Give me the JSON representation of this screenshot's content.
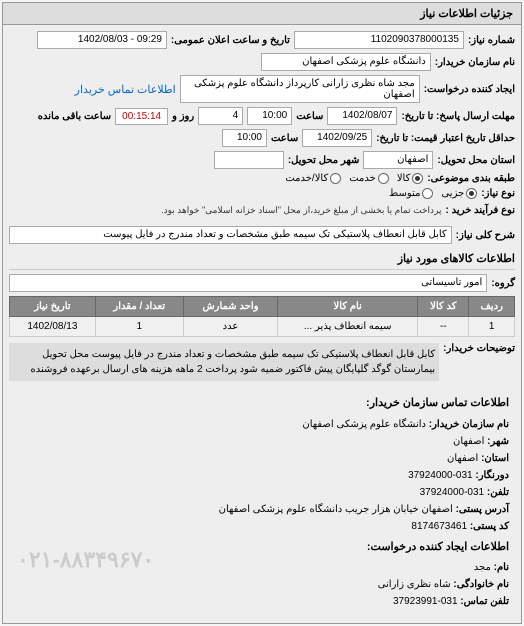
{
  "panel_title": "جزئیات اطلاعات نیاز",
  "fields": {
    "request_no_label": "شماره نیاز:",
    "request_no": "1102090378000135",
    "public_date_label": "تاریخ و ساعت اعلان عمومی:",
    "public_date": "09:29 - 1402/08/03",
    "buyer_name_label": "نام سازمان خریدار:",
    "buyer_name": "دانشگاه علوم پزشکی اصفهان",
    "requester_label": "ایجاد کننده درخواست:",
    "requester": "مجد شاه نظری زارانی کارپرداز دانشگاه علوم پزشکی اصفهان",
    "buyer_contact_link": "اطلاعات تماس خریدار",
    "response_deadline_label": "مهلت ارسال پاسخ: تا تاریخ:",
    "response_date": "1402/08/07",
    "time_label": "ساعت",
    "response_time": "10:00",
    "days_label": "روز و",
    "days_value": "4",
    "remaining_label": "ساعت باقی مانده",
    "countdown": "00:15:14",
    "validity_label": "حداقل تاریخ اعتبار قیمت: تا تاریخ:",
    "validity_date": "1402/09/25",
    "validity_time": "10:00",
    "delivery_province_label": "استان محل تحویل:",
    "delivery_province": "اصفهان",
    "delivery_city_label": "شهر محل تحویل:",
    "category_label": "طبقه بندی موضوعی:",
    "type_label": "نوع نیاز:",
    "purchase_process_label": "نوع فرآیند خرید :",
    "note_text": "پرداخت تمام یا بخشی از مبلغ خرید،از محل \"اسناد خزانه اسلامی\" خواهد بود.",
    "desc_title_label": "شرح کلی نیاز:",
    "desc_title": "کابل قابل انعطاف پلاستیکی تک سیمه طبق مشخصات و تعداد مندرج در فایل پیوست",
    "goods_section": "اطلاعات کالاهای مورد نیاز",
    "group_label": "گروه:",
    "group_value": "امور تاسیساتی"
  },
  "radios": {
    "category": [
      {
        "label": "کالا",
        "checked": true
      },
      {
        "label": "خدمت",
        "checked": false
      },
      {
        "label": "کالا/خدمت",
        "checked": false
      }
    ],
    "type": [
      {
        "label": "جزیی",
        "checked": true
      },
      {
        "label": "متوسط",
        "checked": false
      }
    ]
  },
  "table": {
    "headers": [
      "ردیف",
      "کد کالا",
      "نام کالا",
      "واحد شمارش",
      "تعداد / مقدار",
      "تاریخ نیاز"
    ],
    "rows": [
      {
        "idx": "1",
        "code": "--",
        "name": "سیمه انعطاف پذیر  ...",
        "unit": "عدد",
        "qty": "1",
        "date": "1402/08/13"
      }
    ]
  },
  "description": {
    "label": "توضیحات خریدار:",
    "text": "کابل قابل انعطاف پلاستیکی تک سیمه طبق مشخصات و تعداد مندرج در فایل پیوست محل تحویل بیمارستان گوگد گلپایگان پیش فاکتور ضمیه شود پرداخت 2 ماهه هزینه های ارسال برعهده فروشنده"
  },
  "contact": {
    "section_title": "اطلاعات تماس سازمان خریدار:",
    "org_label": "نام سازمان خریدار:",
    "org": "دانشگاه علوم پزشکی اصفهان",
    "city_label": "شهر:",
    "city": "اصفهان",
    "province_label": "استان:",
    "province": "اصفهان",
    "fax_label": "دورنگار:",
    "fax": "031-37924000",
    "phone_label": "تلفن:",
    "phone": "031-37924000",
    "postal_label": "آدرس پستی:",
    "postal": "اصفهان خیابان هزار جریب دانشگاه علوم پزشکی اصفهان",
    "zip_label": "کد پستی:",
    "zip": "8174673461",
    "req_contact_title": "اطلاعات ایجاد کننده درخواست:",
    "name_label": "نام:",
    "name": "مجد",
    "lastname_label": "نام خانوادگی:",
    "lastname": "شاه نظری زارانی",
    "tel_label": "تلفن تماس:",
    "tel": "031-37923991"
  },
  "watermark": "۰۲۱-۸۸۳۴۹۶۷۰"
}
